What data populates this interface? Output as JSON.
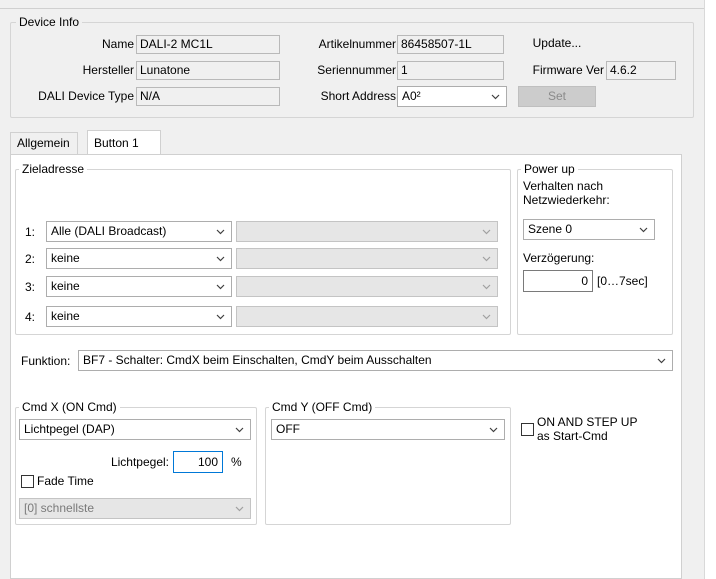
{
  "device_info": {
    "legend": "Device Info",
    "name_label": "Name",
    "name_value": "DALI-2 MC1L",
    "manufacturer_label": "Hersteller",
    "manufacturer_value": "Lunatone",
    "device_type_label": "DALI Device Type",
    "device_type_value": "N/A",
    "article_label": "Artikelnummer",
    "article_value": "86458507-1L",
    "serial_label": "Seriennummer",
    "serial_value": "1",
    "short_address_label": "Short Address",
    "short_address_value": "A0²",
    "update_button": "Update...",
    "firmware_label": "Firmware Ver",
    "firmware_value": "4.6.2",
    "set_button": "Set"
  },
  "tabs": [
    {
      "label": "Allgemein",
      "active": false
    },
    {
      "label": "Button 1",
      "active": true
    }
  ],
  "target_address": {
    "legend": "Zieladresse",
    "rows": [
      {
        "index": "1:",
        "value": "Alle (DALI Broadcast)"
      },
      {
        "index": "2:",
        "value": "keine"
      },
      {
        "index": "3:",
        "value": "keine"
      },
      {
        "index": "4:",
        "value": "keine"
      }
    ]
  },
  "power_up": {
    "legend": "Power up",
    "behavior_label_line1": "Verhalten nach",
    "behavior_label_line2": "Netzwiederkehr:",
    "behavior_value": "Szene 0",
    "delay_label": "Verzögerung:",
    "delay_value": "0",
    "delay_range": "[0…7sec]"
  },
  "function": {
    "label": "Funktion:",
    "value": "BF7 - Schalter:  CmdX beim Einschalten, CmdY beim Ausschalten"
  },
  "cmd_x": {
    "legend": "Cmd X  (ON Cmd)",
    "value": "Lichtpegel  (DAP)",
    "level_label": "Lichtpegel:",
    "level_value": "100",
    "level_unit": "%",
    "fade_time_label": "Fade Time",
    "fade_time_value": "[0]    schnellste"
  },
  "cmd_y": {
    "legend": "Cmd Y  (OFF Cmd)",
    "value": "OFF"
  },
  "on_and_step_up": {
    "line1": "ON AND STEP UP",
    "line2": "as Start-Cmd"
  }
}
